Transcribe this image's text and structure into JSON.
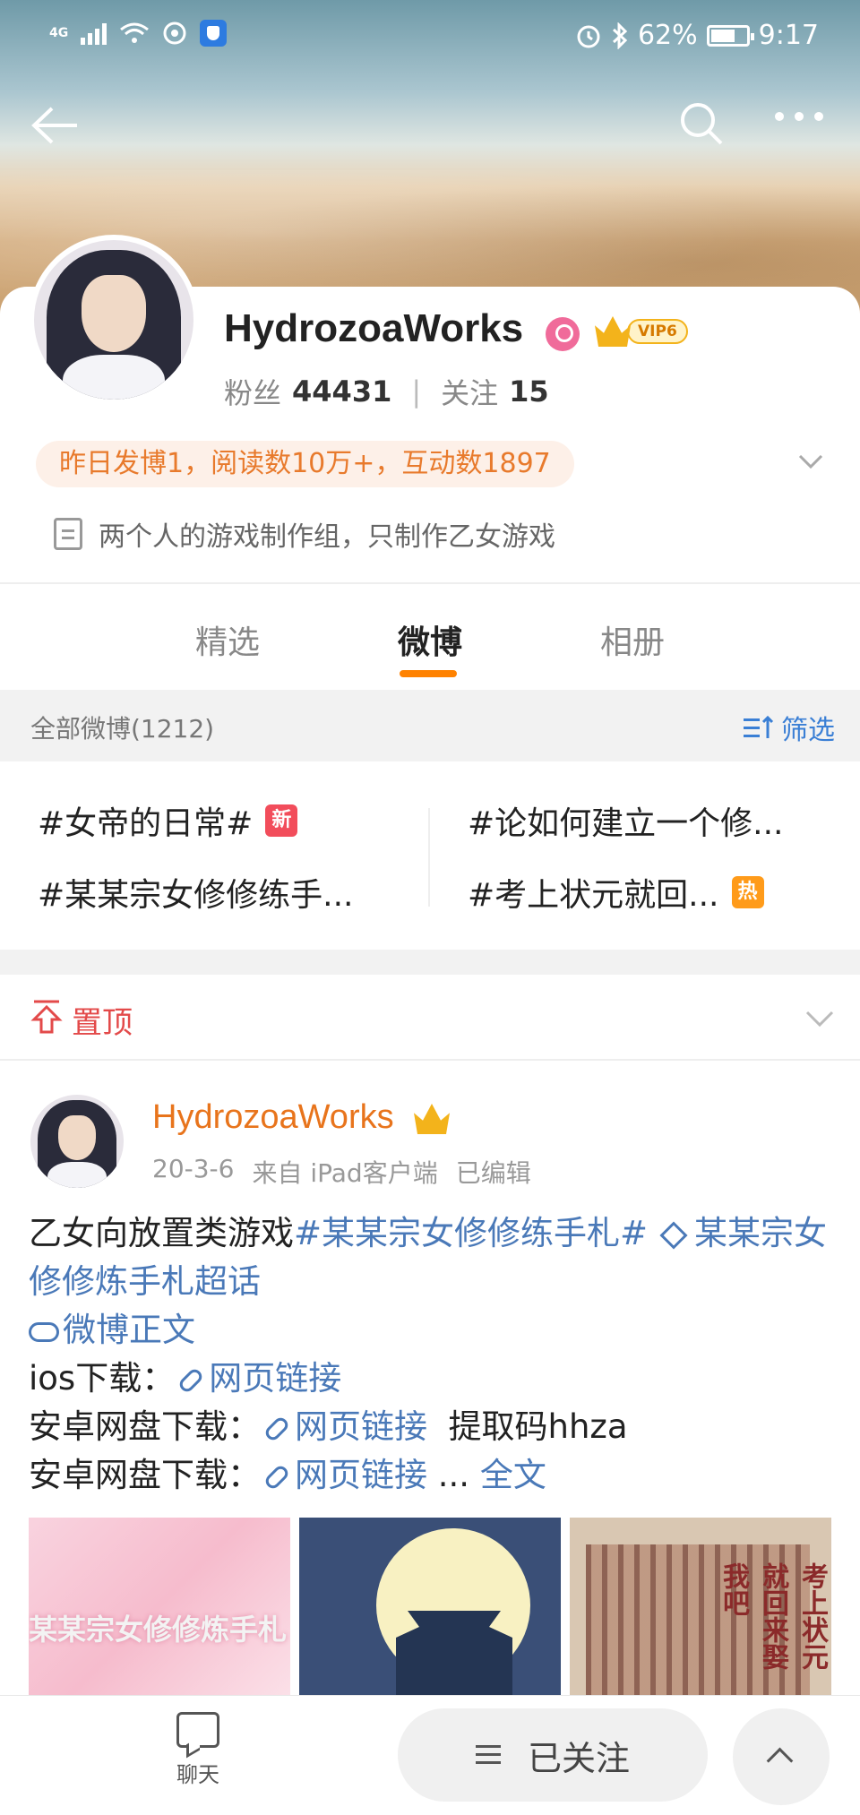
{
  "status_bar": {
    "signal_label": "4G",
    "battery": "62%",
    "time": "9:17"
  },
  "header": {
    "back_icon": "back-arrow-icon",
    "search_icon": "search-icon",
    "more_icon": "more-icon"
  },
  "profile": {
    "username": "HydrozoaWorks",
    "vip_label": "VIP6",
    "fans_label": "粉丝",
    "fans_count": "44431",
    "following_label": "关注",
    "following_count": "15",
    "activity": "昨日发博1，阅读数10万+，互动数1897",
    "bio": "两个人的游戏制作组，只制作乙女游戏"
  },
  "tabs": [
    {
      "label": "精选"
    },
    {
      "label": "微博"
    },
    {
      "label": "相册"
    }
  ],
  "filter": {
    "label": "全部微博(1212)",
    "button": "筛选"
  },
  "topics": [
    {
      "label": "#女帝的日常#",
      "tag": "新"
    },
    {
      "label": "#论如何建立一个修..."
    },
    {
      "label": "#某某宗女修修练手..."
    },
    {
      "label": "#考上状元就回...",
      "tag": "热"
    }
  ],
  "pinned": {
    "label": "置顶"
  },
  "post": {
    "author": "HydrozoaWorks",
    "date": "20-3-6",
    "source": "来自 iPad客户端",
    "edited": "已编辑",
    "line1_text": "乙女向放置类游戏",
    "line1_hashtag": "#某某宗女修修练手札#",
    "line1_super": "某某宗女修修炼手札超话",
    "weibo_text_link": "微博正文",
    "ios_label": "ios下载：",
    "web_link": "网页链接",
    "android_label": "安卓网盘下载：",
    "extract_code": "提取码hhza",
    "ellipsis": "...",
    "full_text": "全文",
    "thumb1_text": "某某宗女修修炼手札",
    "thumb3_text": "考上状元就回来娶我吧"
  },
  "bottom_bar": {
    "chat_label": "聊天",
    "follow_label": "已关注"
  }
}
